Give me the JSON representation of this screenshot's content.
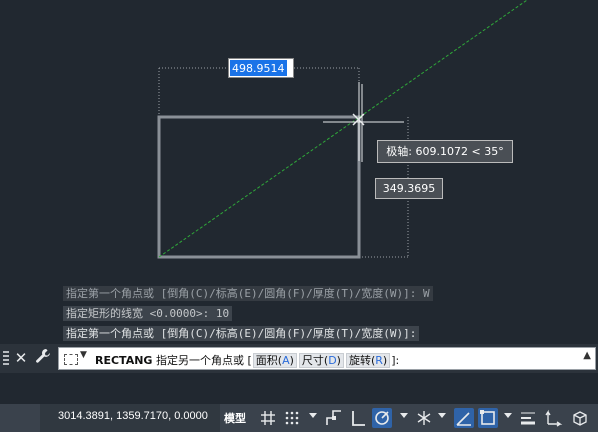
{
  "dynamic_input": {
    "width_value": "498.9514",
    "height_value": "349.3695",
    "polar_tooltip": "极轴: 609.1072 < 35°"
  },
  "command_history": [
    "指定第一个角点或 [倒角(C)/标高(E)/圆角(F)/厚度(T)/宽度(W)]: W",
    "指定矩形的线宽 <0.0000>: 10",
    "指定第一个角点或 [倒角(C)/标高(E)/圆角(F)/厚度(T)/宽度(W)]:"
  ],
  "command_line": {
    "command": "RECTANG",
    "prompt": "指定另一个角点或",
    "options": [
      {
        "label": "面积",
        "key": "A"
      },
      {
        "label": "尺寸",
        "key": "D"
      },
      {
        "label": "旋转",
        "key": "R"
      }
    ],
    "close_icon": "close-icon",
    "customize_icon": "wrench-icon"
  },
  "status_bar": {
    "coordinates": "3014.3891, 1359.7170, 0.0000",
    "model_label": "模型",
    "icons": [
      "grid-icon",
      "snap-icon",
      "infer-constraints-icon",
      "ortho-icon",
      "polar-tracking-icon",
      "isometric-icon",
      "object-snap-tracking-icon",
      "object-snap-icon",
      "lineweight-icon",
      "annotation-scale-icon",
      "workspace-icon"
    ]
  },
  "colors": {
    "canvas": "#212830",
    "rectangle": "#8a9097",
    "tracking_line": "#2fa83a",
    "highlight": "#1a73e8"
  }
}
